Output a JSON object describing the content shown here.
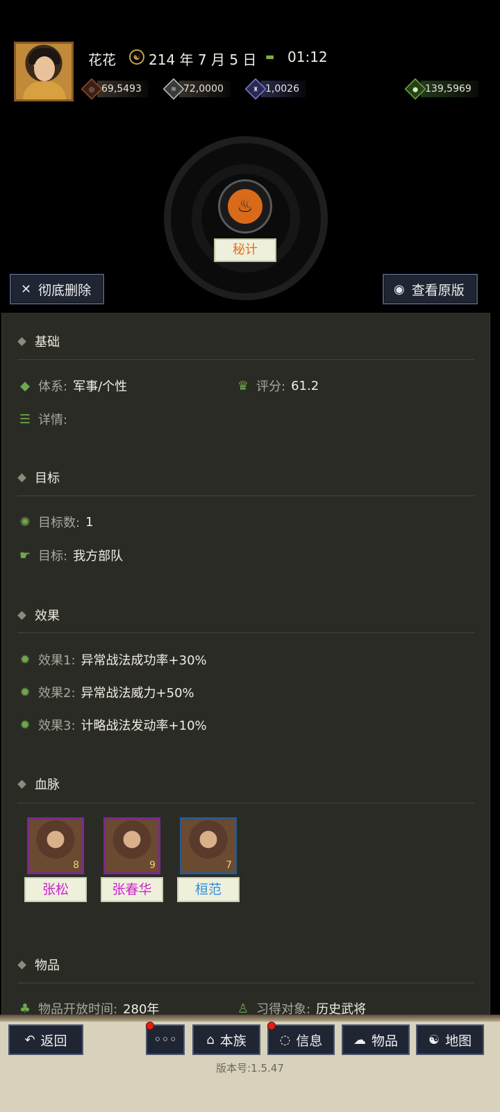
{
  "player": {
    "name": "花花",
    "date": "214 年 7 月 5 日",
    "time": "01:12"
  },
  "resources": [
    {
      "icon": "coin-icon",
      "value": "69,5493"
    },
    {
      "icon": "grain-icon",
      "value": "72,0000"
    },
    {
      "icon": "soldier-icon",
      "value": "1,0026"
    },
    {
      "icon": "money-bag-icon",
      "value": "139,5969"
    }
  ],
  "skill": {
    "type_tag": "秘计"
  },
  "actions": {
    "delete_label": "彻底删除",
    "view_origin_label": "查看原版"
  },
  "sections": {
    "basic": {
      "title": "基础",
      "system_label": "体系:",
      "system_value": "军事/个性",
      "score_label": "评分:",
      "score_value": "61.2",
      "detail_label": "详情:"
    },
    "target": {
      "title": "目标",
      "count_label": "目标数:",
      "count_value": "1",
      "target_label": "目标:",
      "target_value": "我方部队"
    },
    "effect": {
      "title": "效果",
      "items": [
        {
          "label": "效果1:",
          "value": "异常战法成功率+30%"
        },
        {
          "label": "效果2:",
          "value": "异常战法威力+50%"
        },
        {
          "label": "效果3:",
          "value": "计略战法发动率+10%"
        }
      ]
    },
    "bloodline": {
      "title": "血脉",
      "characters": [
        {
          "name": "张松",
          "level": "8"
        },
        {
          "name": "张春华",
          "level": "9"
        },
        {
          "name": "桓范",
          "level": "7"
        }
      ]
    },
    "item": {
      "title": "物品",
      "open_time_label": "物品开放时间:",
      "open_time_value": "280年",
      "learn_label": "习得对象:",
      "learn_value": "历史武将"
    }
  },
  "nav": {
    "back": "返回",
    "more": "◦◦◦",
    "clan": "本族",
    "info": "信息",
    "items": "物品",
    "map": "地图"
  },
  "version": "版本号:1.5.47",
  "colors": {
    "panel_bg": "#2b2b26",
    "button_bg": "#1f2533",
    "accent_orange": "#e0701a",
    "purple_name": "#d020d0",
    "blue_name": "#2c8ee0"
  }
}
